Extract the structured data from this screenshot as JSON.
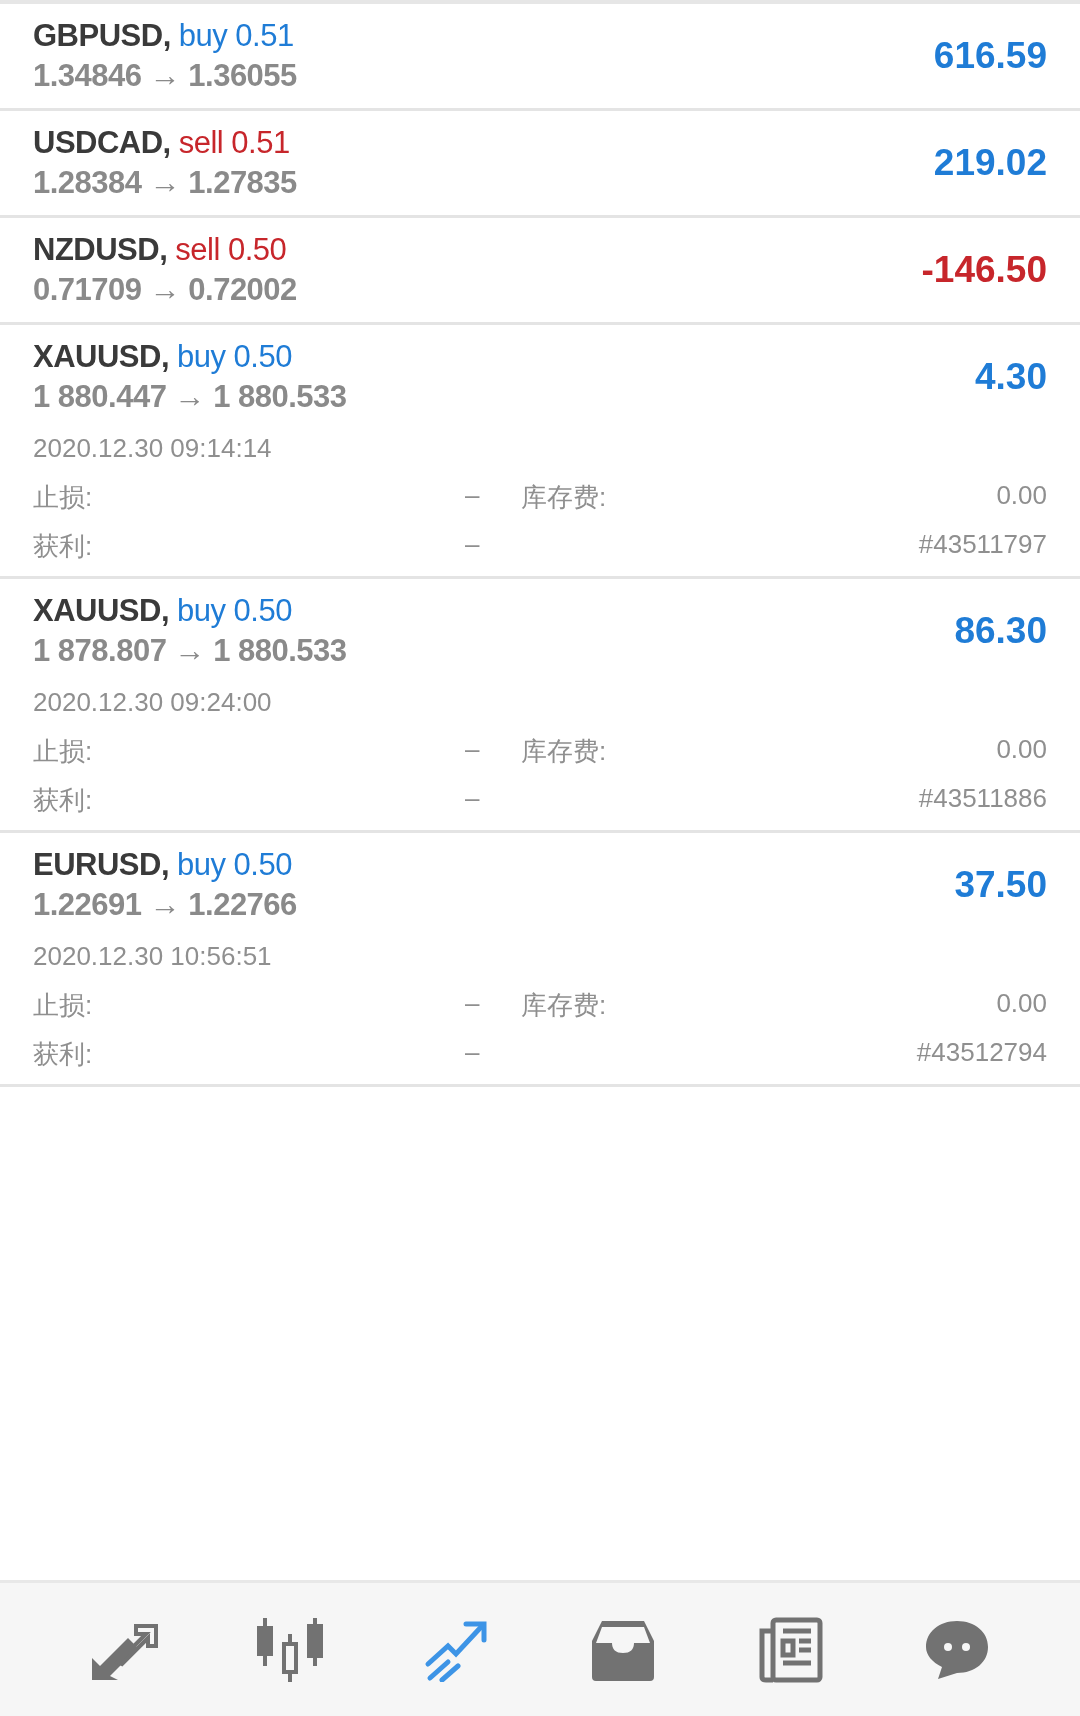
{
  "positions": [
    {
      "symbol": "GBPUSD,",
      "kind": "buy",
      "action": "buy 0.51",
      "prices": "1.34846 → 1.36055",
      "profit": "616.59",
      "loss": false,
      "expanded": false
    },
    {
      "symbol": "USDCAD,",
      "kind": "sell",
      "action": "sell 0.51",
      "prices": "1.28384 → 1.27835",
      "profit": "219.02",
      "loss": false,
      "expanded": false
    },
    {
      "symbol": "NZDUSD,",
      "kind": "sell",
      "action": "sell 0.50",
      "prices": "0.71709 → 0.72002",
      "profit": "-146.50",
      "loss": true,
      "expanded": false
    },
    {
      "symbol": "XAUUSD,",
      "kind": "buy",
      "action": "buy 0.50",
      "prices": "1 880.447 → 1 880.533",
      "profit": "4.30",
      "loss": false,
      "expanded": true,
      "details": {
        "time": "2020.12.30 09:14:14",
        "sl_label": "止损:",
        "sl": "–",
        "swap_label": "库存费:",
        "swap": "0.00",
        "tp_label": "获利:",
        "tp": "–",
        "ticket": "#43511797"
      }
    },
    {
      "symbol": "XAUUSD,",
      "kind": "buy",
      "action": "buy 0.50",
      "prices": "1 878.807 → 1 880.533",
      "profit": "86.30",
      "loss": false,
      "expanded": true,
      "details": {
        "time": "2020.12.30 09:24:00",
        "sl_label": "止损:",
        "sl": "–",
        "swap_label": "库存费:",
        "swap": "0.00",
        "tp_label": "获利:",
        "tp": "–",
        "ticket": "#43511886"
      }
    },
    {
      "symbol": "EURUSD,",
      "kind": "buy",
      "action": "buy 0.50",
      "prices": "1.22691 → 1.22766",
      "profit": "37.50",
      "loss": false,
      "expanded": true,
      "details": {
        "time": "2020.12.30 10:56:51",
        "sl_label": "止损:",
        "sl": "–",
        "swap_label": "库存费:",
        "swap": "0.00",
        "tp_label": "获利:",
        "tp": "–",
        "ticket": "#43512794"
      }
    }
  ],
  "nav": [
    {
      "kind": "trade",
      "selected": false
    },
    {
      "kind": "chart",
      "selected": false
    },
    {
      "kind": "history",
      "selected": true
    },
    {
      "kind": "inbox",
      "selected": false
    },
    {
      "kind": "news",
      "selected": false
    },
    {
      "kind": "chat",
      "selected": false
    }
  ]
}
